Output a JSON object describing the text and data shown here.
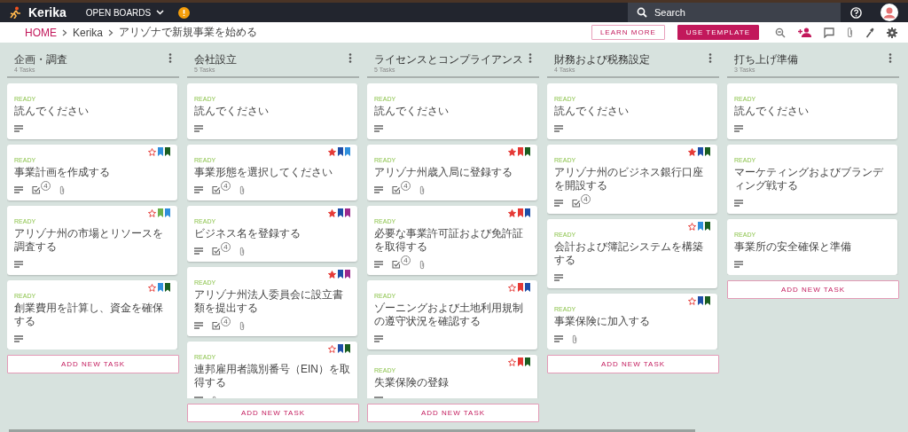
{
  "app": {
    "name": "Kerika",
    "menu": "OPEN BOARDS"
  },
  "search": {
    "placeholder": "Search"
  },
  "breadcrumb": [
    "HOME",
    "Kerika",
    "アリゾナで新規事業を始める"
  ],
  "buttons": [
    {
      "label": "LEARN MORE",
      "kind": "outline"
    },
    {
      "label": "USE TEMPLATE",
      "kind": "filled"
    }
  ],
  "columns": [
    {
      "title": "企画・調査",
      "count": "4 Tasks",
      "add_label": "ADD NEW TASK",
      "tasks": [
        {
          "status": "READY",
          "title": "読んでください",
          "starred": false,
          "attachment": false
        },
        {
          "status": "READY",
          "title": "事業計画を作成する",
          "starred": false,
          "tags": [
            {
              "color": "#2f8fdc"
            },
            {
              "color": "#1b5e20"
            }
          ],
          "checklist_count": "4",
          "attachment": true
        },
        {
          "status": "READY",
          "title": "アリゾナ州の市場とリソースを調査する",
          "starred": false,
          "tags": [
            {
              "color": "#6ab04c"
            },
            {
              "color": "#2f8fdc"
            }
          ],
          "attachment": false
        },
        {
          "status": "READY",
          "title": "創業費用を計算し、資金を確保する",
          "starred": false,
          "tags": [
            {
              "color": "#2f8fdc"
            },
            {
              "color": "#1b5e20"
            }
          ],
          "attachment": false
        }
      ]
    },
    {
      "title": "会社設立",
      "count": "5 Tasks",
      "add_label": "ADD NEW TASK",
      "tasks": [
        {
          "status": "READY",
          "title": "読んでください",
          "starred": false,
          "attachment": false
        },
        {
          "status": "READY",
          "title": "事業形態を選択してください",
          "starred": true,
          "tags": [
            {
              "color": "#1e4fa8"
            },
            {
              "color": "#2f8fdc"
            }
          ],
          "checklist_count": "4",
          "attachment": true
        },
        {
          "status": "READY",
          "title": "ビジネス名を登録する",
          "starred": true,
          "tags": [
            {
              "color": "#1e4fa8"
            },
            {
              "color": "#9c2a8e"
            }
          ],
          "checklist_count": "4",
          "attachment": true
        },
        {
          "status": "READY",
          "title": "アリゾナ州法人委員会に設立書類を提出する",
          "starred": true,
          "tags": [
            {
              "color": "#1e4fa8"
            },
            {
              "color": "#9c2a8e"
            }
          ],
          "checklist_count": "4",
          "attachment": true
        },
        {
          "status": "READY",
          "title": "連邦雇用者識別番号（EIN）を取得する",
          "starred": false,
          "tags": [
            {
              "color": "#1e4fa8"
            },
            {
              "color": "#1b5e20"
            }
          ],
          "attachment": true
        }
      ]
    },
    {
      "title": "ライセンスとコンプライアンス",
      "count": "5 Tasks",
      "add_label": "ADD NEW TASK",
      "tasks": [
        {
          "status": "READY",
          "title": "読んでください",
          "starred": false,
          "attachment": false
        },
        {
          "status": "READY",
          "title": "アリゾナ州歳入局に登録する",
          "starred": true,
          "tags": [
            {
              "color": "#e53935"
            },
            {
              "color": "#1b5e20"
            }
          ],
          "checklist_count": "4",
          "attachment": true
        },
        {
          "status": "READY",
          "title": "必要な事業許可証および免許証を取得する",
          "starred": true,
          "tags": [
            {
              "color": "#e53935"
            },
            {
              "color": "#1e4fa8"
            }
          ],
          "checklist_count": "4",
          "attachment": true
        },
        {
          "status": "READY",
          "title": "ゾーニングおよび土地利用規制の遵守状況を確認する",
          "starred": false,
          "tags": [
            {
              "color": "#e53935"
            },
            {
              "color": "#1e4fa8"
            }
          ],
          "attachment": false
        },
        {
          "status": "READY",
          "title": "失業保険の登録",
          "starred": false,
          "tags": [
            {
              "color": "#e53935"
            },
            {
              "color": "#1b5e20"
            }
          ],
          "attachment": false
        }
      ]
    },
    {
      "title": "財務および税務設定",
      "count": "4 Tasks",
      "add_label": "ADD NEW TASK",
      "tasks": [
        {
          "status": "READY",
          "title": "読んでください",
          "starred": false,
          "attachment": false
        },
        {
          "status": "READY",
          "title": "アリゾナ州のビジネス銀行口座を開設する",
          "starred": true,
          "tags": [
            {
              "color": "#1e4fa8"
            },
            {
              "color": "#1b5e20"
            }
          ],
          "checklist_count": "4",
          "attachment": false
        },
        {
          "status": "READY",
          "title": "会計および簿記システムを構築する",
          "starred": false,
          "tags": [
            {
              "color": "#2f8fdc"
            },
            {
              "color": "#1b5e20"
            }
          ],
          "attachment": false
        },
        {
          "status": "READY",
          "title": "事業保険に加入する",
          "starred": false,
          "tags": [
            {
              "color": "#1e4fa8"
            },
            {
              "color": "#1b5e20"
            }
          ],
          "attachment": true
        }
      ]
    },
    {
      "title": "打ち上げ準備",
      "count": "3 Tasks",
      "add_label": "ADD NEW TASK",
      "tasks": [
        {
          "status": "READY",
          "title": "読んでください",
          "starred": false,
          "attachment": false
        },
        {
          "status": "READY",
          "title": "マーケティングおよびブランディング戦する",
          "starred": false,
          "attachment": false
        },
        {
          "status": "READY",
          "title": "事業所の安全確保と準備",
          "starred": false,
          "attachment": false
        }
      ]
    }
  ]
}
